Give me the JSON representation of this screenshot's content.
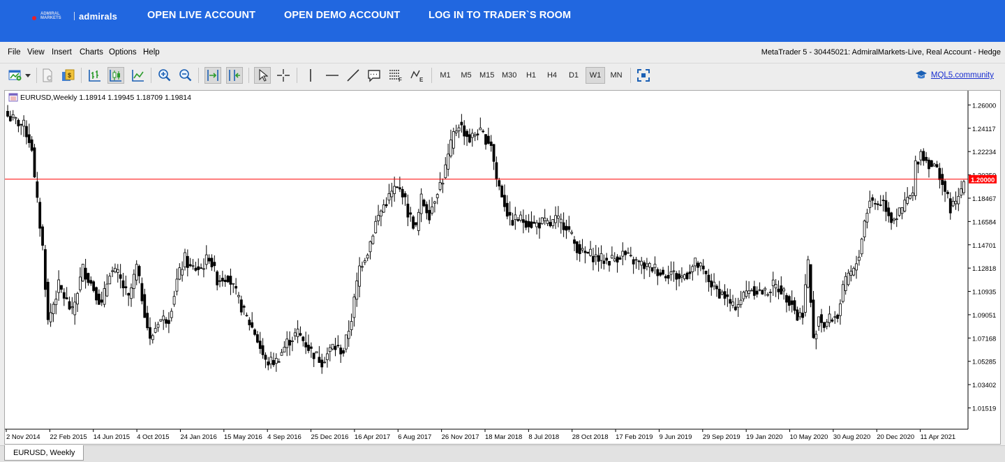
{
  "header": {
    "logo_small": "ADMIRAL MARKETS",
    "logo_text": "admirals",
    "links": [
      "OPEN LIVE ACCOUNT",
      "OPEN DEMO ACCOUNT",
      "LOG IN TO TRADER`S ROOM"
    ]
  },
  "menu": [
    "File",
    "View",
    "Insert",
    "Charts",
    "Options",
    "Help"
  ],
  "window_title": "MetaTrader 5 - 30445021: AdmiralMarkets-Live, Real Account - Hedge",
  "toolbar": {
    "icons": [
      "new-chart-icon",
      "dropdown-arrow-icon",
      "new-order-icon",
      "market-icon",
      "bar-chart-icon",
      "candlestick-icon",
      "line-chart-icon",
      "zoom-in-icon",
      "zoom-out-icon",
      "autoscroll-icon",
      "chart-shift-icon",
      "cursor-icon",
      "crosshair-icon",
      "vertical-line-icon",
      "horizontal-line-icon",
      "trendline-icon",
      "text-icon",
      "fibonacci-icon",
      "elliott-icon",
      "fullscreen-icon"
    ],
    "timeframes": [
      "M1",
      "M5",
      "M15",
      "M30",
      "H1",
      "H4",
      "D1",
      "W1",
      "MN"
    ],
    "active_timeframe": "W1",
    "community_label": "MQL5.community"
  },
  "chart": {
    "header": "EURUSD,Weekly  1.18914 1.19945 1.18709 1.19814",
    "tab_label": "EURUSD, Weekly",
    "hline_label": "1.20000",
    "hline_color": "#ff0000"
  },
  "chart_data": {
    "type": "candlestick",
    "symbol": "EURUSD",
    "timeframe": "Weekly",
    "last_bar": {
      "open": 1.18914,
      "high": 1.19945,
      "low": 1.18709,
      "close": 1.19814
    },
    "horizontal_line": 1.2,
    "ylim": [
      0.998,
      1.2715
    ],
    "yticks": [
      "1.26000",
      "1.24117",
      "1.22234",
      "1.20350",
      "1.18467",
      "1.16584",
      "1.14701",
      "1.12818",
      "1.10935",
      "1.09051",
      "1.07168",
      "1.05285",
      "1.03402",
      "1.01519"
    ],
    "xticks": [
      "2 Nov 2014",
      "22 Feb 2015",
      "14 Jun 2015",
      "4 Oct 2015",
      "24 Jan 2016",
      "15 May 2016",
      "4 Sep 2016",
      "25 Dec 2016",
      "16 Apr 2017",
      "6 Aug 2017",
      "26 Nov 2017",
      "18 Mar 2018",
      "8 Jul 2018",
      "28 Oct 2018",
      "17 Feb 2019",
      "9 Jun 2019",
      "29 Sep 2019",
      "19 Jan 2020",
      "10 May 2020",
      "30 Aug 2020",
      "20 Dec 2020",
      "11 Apr 2021"
    ],
    "close_path": [
      [
        0,
        1.251
      ],
      [
        6,
        1.243
      ],
      [
        9,
        1.226
      ],
      [
        10,
        1.199
      ],
      [
        13,
        1.145
      ],
      [
        15,
        1.085
      ],
      [
        19,
        1.114
      ],
      [
        24,
        1.092
      ],
      [
        28,
        1.128
      ],
      [
        32,
        1.112
      ],
      [
        35,
        1.098
      ],
      [
        38,
        1.126
      ],
      [
        41,
        1.123
      ],
      [
        45,
        1.103
      ],
      [
        48,
        1.129
      ],
      [
        53,
        1.069
      ],
      [
        56,
        1.086
      ],
      [
        60,
        1.088
      ],
      [
        63,
        1.118
      ],
      [
        66,
        1.136
      ],
      [
        68,
        1.128
      ],
      [
        72,
        1.128
      ],
      [
        75,
        1.138
      ],
      [
        78,
        1.119
      ],
      [
        82,
        1.122
      ],
      [
        86,
        1.102
      ],
      [
        88,
        1.092
      ],
      [
        92,
        1.076
      ],
      [
        96,
        1.052
      ],
      [
        100,
        1.053
      ],
      [
        104,
        1.068
      ],
      [
        108,
        1.076
      ],
      [
        113,
        1.061
      ],
      [
        117,
        1.053
      ],
      [
        121,
        1.065
      ],
      [
        125,
        1.061
      ],
      [
        128,
        1.088
      ],
      [
        131,
        1.129
      ],
      [
        134,
        1.142
      ],
      [
        137,
        1.165
      ],
      [
        140,
        1.179
      ],
      [
        144,
        1.192
      ],
      [
        147,
        1.19
      ],
      [
        149,
        1.173
      ],
      [
        152,
        1.16
      ],
      [
        154,
        1.184
      ],
      [
        157,
        1.172
      ],
      [
        160,
        1.192
      ],
      [
        162,
        1.2
      ],
      [
        164,
        1.218
      ],
      [
        166,
        1.236
      ],
      [
        168,
        1.245
      ],
      [
        172,
        1.232
      ],
      [
        175,
        1.239
      ],
      [
        178,
        1.233
      ],
      [
        180,
        1.229
      ],
      [
        182,
        1.2
      ],
      [
        184,
        1.188
      ],
      [
        187,
        1.166
      ],
      [
        190,
        1.168
      ],
      [
        193,
        1.166
      ],
      [
        196,
        1.163
      ],
      [
        199,
        1.165
      ],
      [
        202,
        1.163
      ],
      [
        204,
        1.167
      ],
      [
        208,
        1.163
      ],
      [
        211,
        1.148
      ],
      [
        214,
        1.14
      ],
      [
        217,
        1.139
      ],
      [
        220,
        1.136
      ],
      [
        223,
        1.134
      ],
      [
        226,
        1.136
      ],
      [
        229,
        1.14
      ],
      [
        232,
        1.135
      ],
      [
        235,
        1.132
      ],
      [
        238,
        1.129
      ],
      [
        241,
        1.128
      ],
      [
        244,
        1.123
      ],
      [
        247,
        1.125
      ],
      [
        250,
        1.12
      ],
      [
        253,
        1.124
      ],
      [
        256,
        1.132
      ],
      [
        258,
        1.128
      ],
      [
        261,
        1.118
      ],
      [
        264,
        1.11
      ],
      [
        267,
        1.106
      ],
      [
        270,
        1.096
      ],
      [
        273,
        1.103
      ],
      [
        276,
        1.112
      ],
      [
        279,
        1.11
      ],
      [
        282,
        1.108
      ],
      [
        285,
        1.114
      ],
      [
        288,
        1.111
      ],
      [
        290,
        1.105
      ],
      [
        292,
        1.101
      ],
      [
        294,
        1.088
      ],
      [
        296,
        1.093
      ],
      [
        298,
        1.133
      ],
      [
        300,
        1.069
      ],
      [
        302,
        1.09
      ],
      [
        304,
        1.082
      ],
      [
        306,
        1.087
      ],
      [
        309,
        1.09
      ],
      [
        311,
        1.11
      ],
      [
        313,
        1.123
      ],
      [
        315,
        1.125
      ],
      [
        317,
        1.14
      ],
      [
        319,
        1.166
      ],
      [
        321,
        1.184
      ],
      [
        323,
        1.18
      ],
      [
        326,
        1.182
      ],
      [
        329,
        1.168
      ],
      [
        332,
        1.172
      ],
      [
        335,
        1.184
      ],
      [
        337,
        1.187
      ],
      [
        338,
        1.212
      ],
      [
        340,
        1.222
      ],
      [
        342,
        1.215
      ],
      [
        345,
        1.21
      ],
      [
        347,
        1.204
      ],
      [
        349,
        1.19
      ],
      [
        351,
        1.177
      ],
      [
        353,
        1.18
      ],
      [
        356,
        1.198
      ]
    ]
  }
}
